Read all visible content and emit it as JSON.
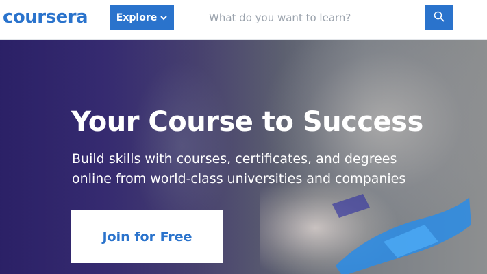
{
  "header": {
    "logo_text": "coursera",
    "explore_label": "Explore",
    "search": {
      "placeholder": "What do you want to learn?",
      "value": ""
    }
  },
  "hero": {
    "title": "Your Course to Success",
    "subtitle": "Build skills with courses, certificates, and degrees online from world-class universities and companies",
    "cta_label": "Join for Free"
  },
  "icons": {
    "explore_caret": "chevron-down-icon",
    "search_button": "search-icon"
  },
  "colors": {
    "brand": "#2a73cc",
    "hero_left": "#2d2268",
    "hero_right": "#8d8f90",
    "white": "#ffffff"
  }
}
